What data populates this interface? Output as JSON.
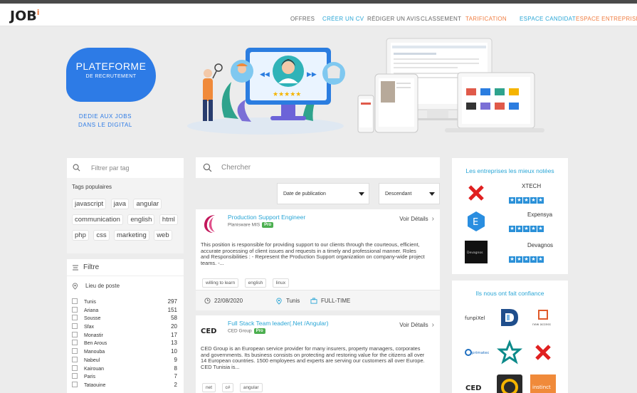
{
  "nav": {
    "logo": "JOB",
    "logo_dot": "i",
    "items": [
      {
        "label": "OFFRES",
        "color": "#666666"
      },
      {
        "label": "CRÉER UN CV",
        "color": "#2aa6d6"
      },
      {
        "label": "RÉDIGER UN AVIS",
        "color": "#666666"
      },
      {
        "label": "CLASSEMENT",
        "color": "#666666"
      },
      {
        "label": "TARIFICATION",
        "color": "#f07c3f"
      },
      {
        "label": "ESPACE CANDIDAT",
        "color": "#2aa6d6"
      },
      {
        "label": "ESPACE ENTREPRISE",
        "color": "#f07c3f"
      }
    ]
  },
  "hero": {
    "title": "PLATEFORME",
    "subtitle": "DE RECRUTEMENT",
    "tagline_1": "DEDIE AUX JOBS",
    "tagline_2": "DANS LE DIGITAL",
    "badge_color": "#2d7be6"
  },
  "sidebar": {
    "tag_search_placeholder": "Filtrer par tag",
    "popular_tags_title": "Tags populaires",
    "tags": [
      "javascript",
      "java",
      "angular",
      "communication",
      "english",
      "html",
      "php",
      "css",
      "marketing",
      "web"
    ],
    "filter_title": "Filtre",
    "location_title": "Lieu de poste",
    "cities": [
      {
        "name": "Tunis",
        "count": "297"
      },
      {
        "name": "Ariana",
        "count": "151"
      },
      {
        "name": "Sousse",
        "count": "58"
      },
      {
        "name": "Sfax",
        "count": "20"
      },
      {
        "name": "Monastir",
        "count": "17"
      },
      {
        "name": "Ben Arous",
        "count": "13"
      },
      {
        "name": "Manouba",
        "count": "10"
      },
      {
        "name": "Nabeul",
        "count": "9"
      },
      {
        "name": "Kairouan",
        "count": "8"
      },
      {
        "name": "Paris",
        "count": "7"
      },
      {
        "name": "Tataouine",
        "count": "2"
      }
    ]
  },
  "main": {
    "search_placeholder": "Chercher",
    "sort_by": "Date de publication",
    "sort_order": "Descendant",
    "jobs": [
      {
        "title": "Production Support Engineer",
        "company": "Planisware MIS",
        "badge": "Pro",
        "details": "Voir Détails",
        "description": "This position is responsible for providing support to our clients through the courteous, efficient, accurate processing of client issues and requests in a timely and professional manner. Roles and Responsibilities : - Represent the Production Support organization on company-wide project teams. -...",
        "skills": [
          "willing to learn",
          "english",
          "linux"
        ],
        "date": "22/08/2020",
        "location": "Tunis",
        "type": "FULL-TIME"
      },
      {
        "title": "Full Stack Team leader(.Net /Angular)",
        "company": "CED Group",
        "badge": "Pro",
        "details": "Voir Détails",
        "logo_text": "CED",
        "description": "CED Group is an European service provider for many insurers, property managers, corporates and governments. Its business consists on protecting and restoring value for the citizens all over 14 European countries. 1500 employees and experts are serving our customers all over Europe. CED Tunisia is...",
        "skills": [
          "net",
          "c#",
          "angular"
        ]
      }
    ]
  },
  "right": {
    "top_title": "Les entreprises les mieux notées",
    "companies": [
      {
        "name": "XTECH",
        "rating": 5,
        "logo": "x-icon"
      },
      {
        "name": "Expensya",
        "rating": 5,
        "logo": "e-icon",
        "logo_text": "E"
      },
      {
        "name": "Devagnos",
        "rating": 5,
        "logo": "devagnos-logo",
        "logo_text": "Devagnos"
      }
    ],
    "bottom_title": "Ils nous ont fait confiance",
    "trust_logos": [
      {
        "name": "funpixel-logo",
        "text": "funpiXel"
      },
      {
        "name": "d-logo"
      },
      {
        "name": "new-access-logo",
        "text": "new access"
      },
      {
        "name": "primatec-logo",
        "text": "primatec"
      },
      {
        "name": "star-logo"
      },
      {
        "name": "x-logo"
      },
      {
        "name": "ced-logo",
        "text": "CED"
      },
      {
        "name": "ring-logo"
      },
      {
        "name": "instinct-logo",
        "text": "instinct"
      }
    ],
    "star_color": "#2a90d8"
  }
}
